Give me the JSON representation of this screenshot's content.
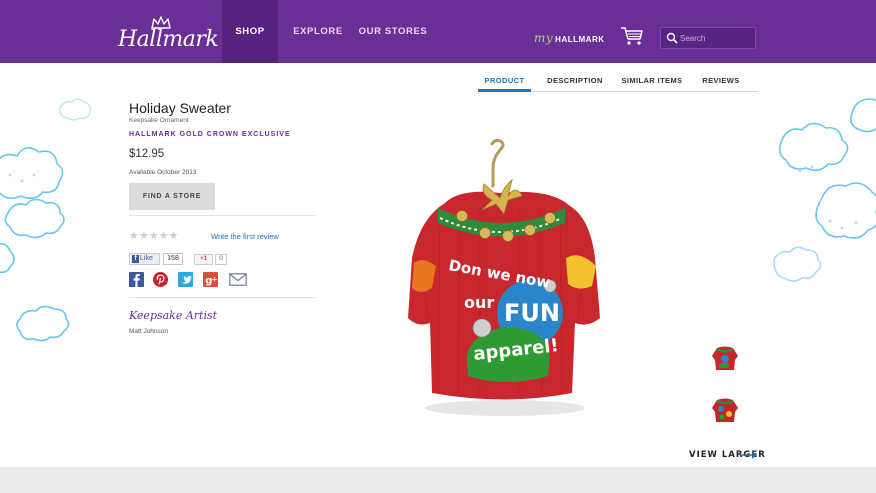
{
  "header": {
    "logo_text": "Hallmark",
    "nav": [
      "SHOP",
      "EXPLORE",
      "OUR STORES"
    ],
    "my_label": "my",
    "my_hallmark_label": "HALLMARK",
    "search_placeholder": "Search",
    "brand_color": "#6a2f96"
  },
  "tabs": [
    "PRODUCT",
    "DESCRIPTION",
    "SIMILAR ITEMS",
    "REVIEWS"
  ],
  "product": {
    "title": "Holiday Sweater",
    "subtitle": "Keepsake Ornament",
    "exclusive": "HALLMARK GOLD CROWN EXCLUSIVE",
    "price": "$12.95",
    "availability": "Available October 2013",
    "find_store_label": "FIND A STORE",
    "stars": "★★★★★",
    "rating": 0,
    "write_review": "Write the first review",
    "fb_like_label": "Like",
    "fb_like_count": "158",
    "gplus_label": "+1",
    "gplus_count": "0",
    "artist_label": "Keepsake Artist",
    "artist_name": "Matt Johnson",
    "sweater_text": [
      "Don we now",
      "our",
      "FUN",
      "apparel!"
    ],
    "view_larger": "VIEW LARGER"
  },
  "share_icons": [
    "facebook-icon",
    "pinterest-icon",
    "twitter-icon",
    "google-plus-icon",
    "email-icon"
  ]
}
